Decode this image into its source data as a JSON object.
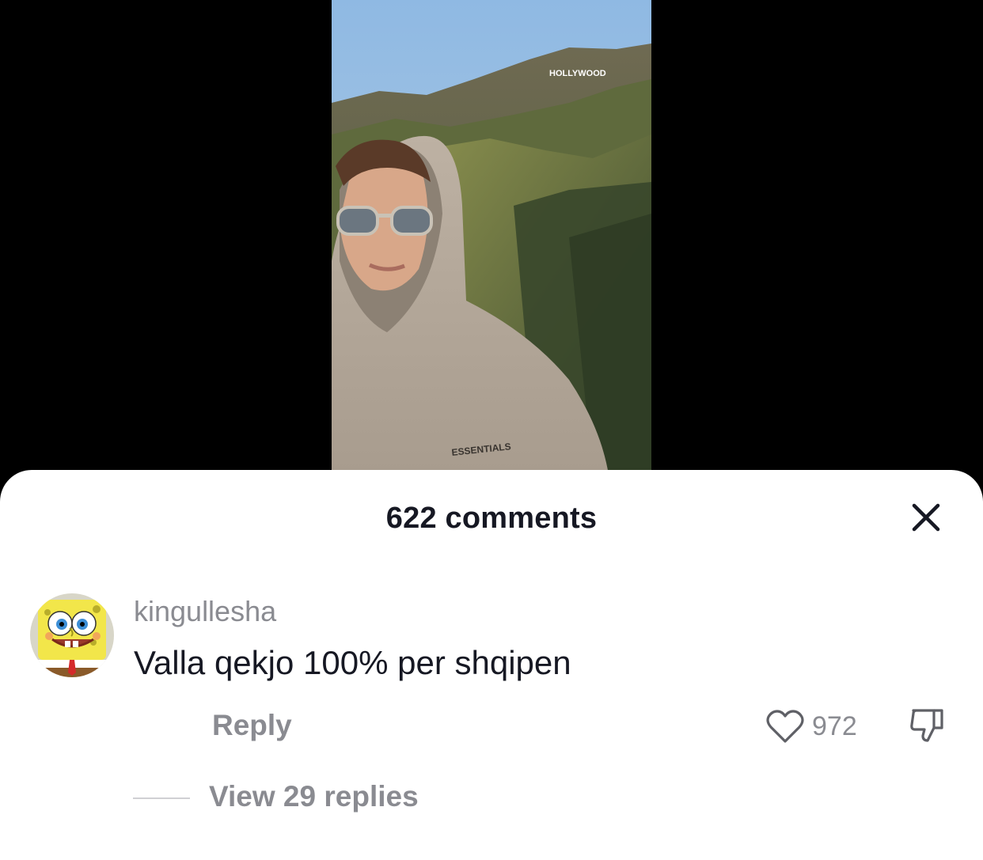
{
  "video": {
    "sign_text": "HOLLYWOOD",
    "hoodie_text": "ESSENTIALS"
  },
  "comments_sheet": {
    "title": "622 comments",
    "comment": {
      "username": "kingullesha",
      "text": "Valla qekjo 100% per shqipen",
      "reply_label": "Reply",
      "like_count": "972",
      "view_replies_label": "View 29 replies",
      "avatar_icon": "spongebob-avatar"
    }
  },
  "icons": {
    "close": "close-icon",
    "like": "heart-icon",
    "dislike": "thumbs-down-icon"
  },
  "colors": {
    "text_primary": "#161823",
    "text_secondary": "#8a8b91",
    "sheet_bg": "#ffffff",
    "backdrop": "#000000"
  }
}
